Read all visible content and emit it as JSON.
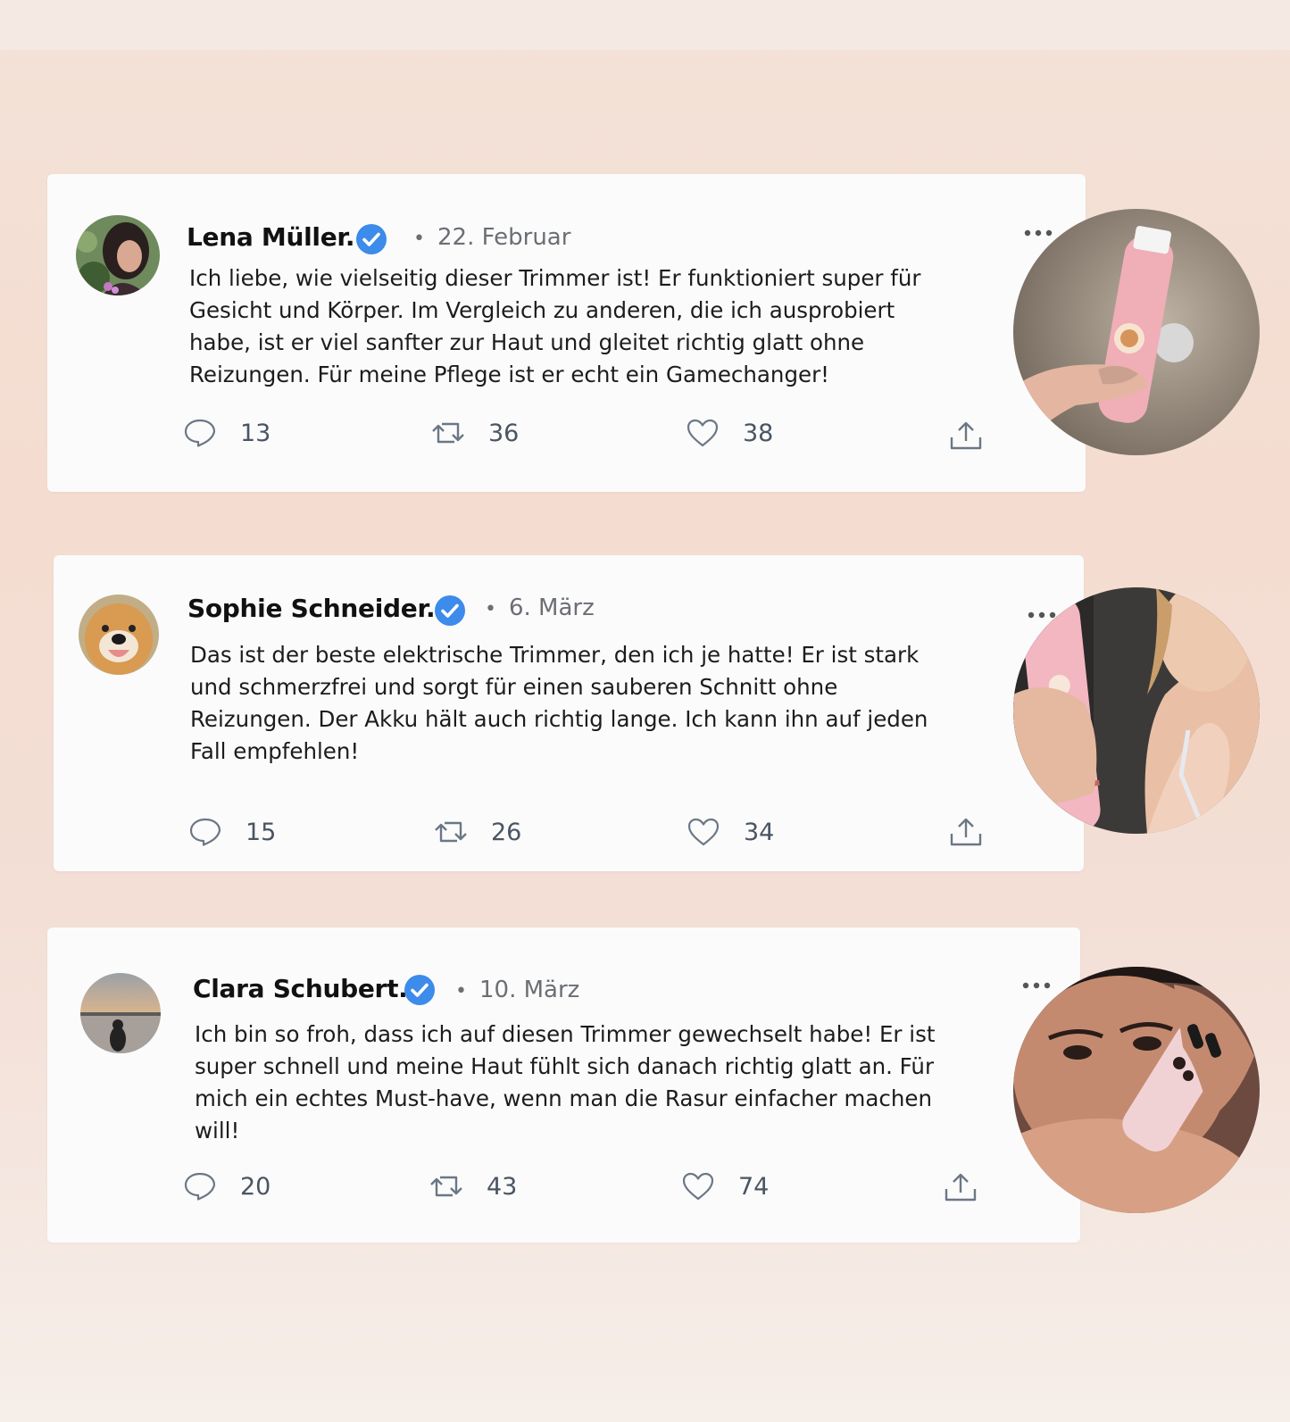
{
  "colors": {
    "verified": "#3d8bea",
    "icon_gray": "#6b7785",
    "count_gray": "#4a5563",
    "card_bg": "#fbfbfb"
  },
  "reviews": [
    {
      "name": "Lena Müller.",
      "date": "22. Februar",
      "text": "Ich liebe, wie vielseitig dieser Trimmer ist! Er funktioniert super für Gesicht und Körper. Im Vergleich zu anderen, die ich ausprobiert habe, ist er viel sanfter zur Haut und gleitet richtig glatt ohne Reizungen. Für meine Pflege ist er echt ein Gamechanger!",
      "replies": "13",
      "retweets": "36",
      "likes": "38",
      "avatar_icon": "avatar-woman-icon",
      "photo_icon": "pink-trimmer-photo"
    },
    {
      "name": "Sophie Schneider.",
      "date": "6. März",
      "text": "Das ist der beste elektrische Trimmer, den ich je hatte! Er ist stark und schmerzfrei und sorgt für einen sauberen Schnitt ohne Reizungen. Der Akku hält auch richtig lange. Ich kann ihn auf jeden Fall empfehlen!",
      "replies": "15",
      "retweets": "26",
      "likes": "34",
      "avatar_icon": "avatar-dog-icon",
      "photo_icon": "woman-with-trimmer-photo"
    },
    {
      "name": "Clara Schubert.",
      "date": "10. März",
      "text": "Ich bin so froh, dass ich auf diesen Trimmer gewechselt habe! Er ist super schnell und meine Haut fühlt sich danach richtig glatt an. Für mich ein echtes Must-have, wenn man die Rasur einfacher machen will!",
      "replies": "20",
      "retweets": "43",
      "likes": "74",
      "avatar_icon": "avatar-sunset-icon",
      "photo_icon": "trimmer-on-arm-photo"
    }
  ]
}
